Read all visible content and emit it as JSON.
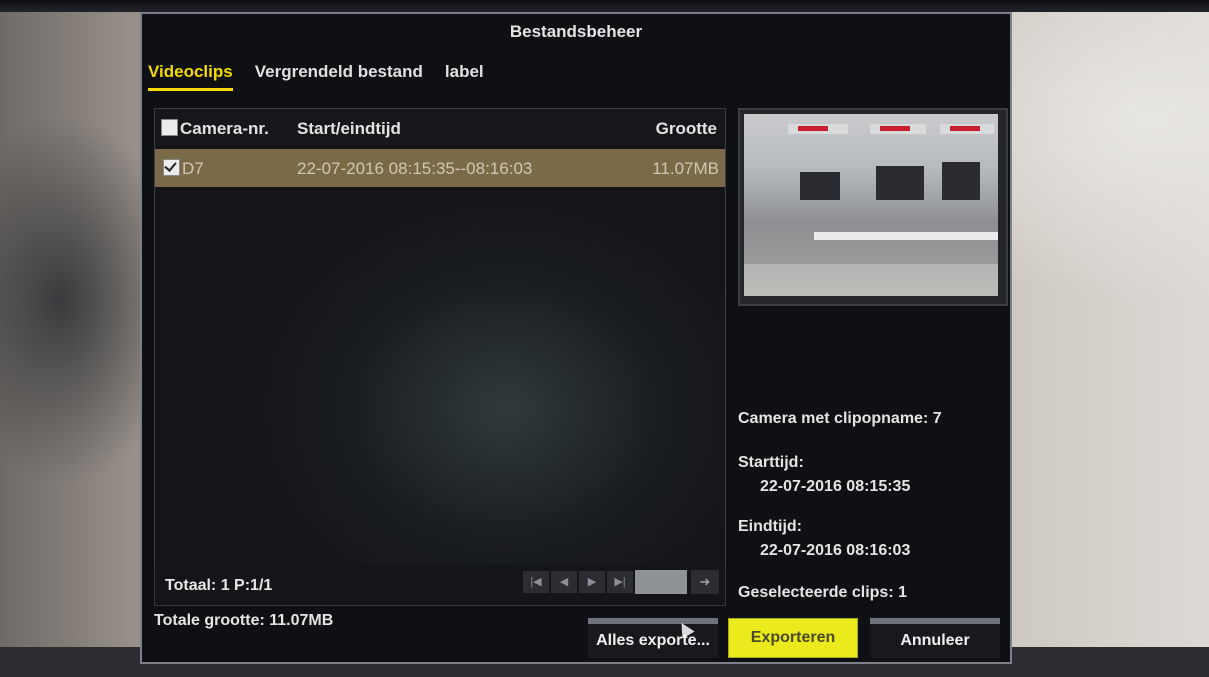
{
  "window": {
    "title": "Bestandsbeheer"
  },
  "tabs": [
    {
      "label": "Videoclips",
      "active": true
    },
    {
      "label": "Vergrendeld bestand",
      "active": false
    },
    {
      "label": "label",
      "active": false
    }
  ],
  "table": {
    "columns": [
      "Camera-nr.",
      "Start/eindtijd",
      "Grootte"
    ],
    "rows": [
      {
        "camera": "D7",
        "time": "22-07-2016 08:15:35--08:16:03",
        "size": "11.07MB",
        "checked": true,
        "selected": true
      }
    ]
  },
  "pager": {
    "total": "Totaal: 1 P:1/1",
    "nav_icons": [
      "first-page-icon",
      "prev-page-icon",
      "next-page-icon",
      "last-page-icon",
      "go-arrow-icon"
    ]
  },
  "details": {
    "camera": "Camera met clipopname: 7",
    "start_label": "Starttijd:",
    "start_value": "22-07-2016 08:15:35",
    "end_label": "Eindtijd:",
    "end_value": "22-07-2016 08:16:03",
    "selected_clips": "Geselecteerde clips: 1"
  },
  "footer": {
    "total_size": "Totale grootte: 11.07MB",
    "buttons": {
      "export_all": "Alles exporte...",
      "export": "Exporteren",
      "cancel": "Annuleer"
    }
  },
  "colors": {
    "accent": "#f5d900",
    "selected_row": "#7b6a47",
    "primary_button": "#eaea1c"
  }
}
